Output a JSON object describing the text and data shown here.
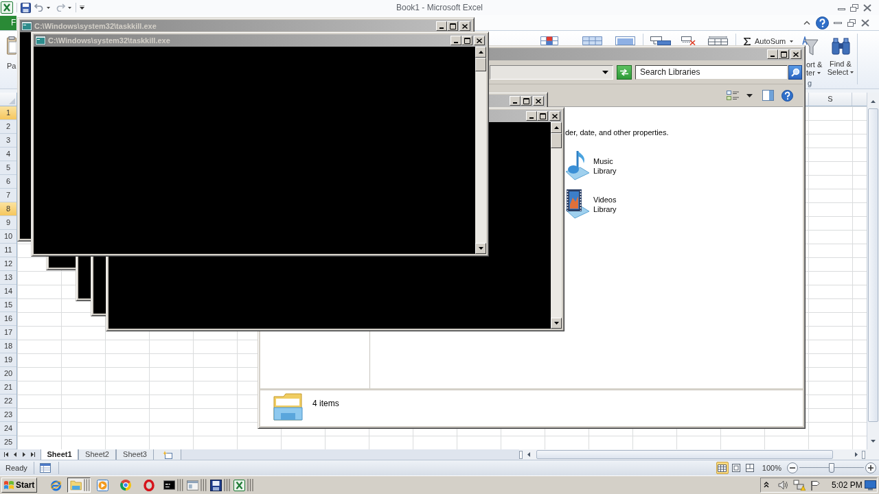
{
  "excel": {
    "title": "Book1 - Microsoft Excel",
    "file_tab": "F",
    "ribbon": {
      "paste": "Pa",
      "autosum": "AutoSum",
      "sort_filter": [
        "ort &",
        "ter"
      ],
      "find_select": [
        "Find &",
        "Select"
      ],
      "editing_group": "g"
    },
    "column_headers": [
      "S"
    ],
    "rows": [
      {
        "label": "1",
        "selected": true
      },
      {
        "label": "2",
        "selected": false
      },
      {
        "label": "3",
        "selected": false
      },
      {
        "label": "4",
        "selected": false
      },
      {
        "label": "5",
        "selected": false
      },
      {
        "label": "6",
        "selected": false
      },
      {
        "label": "7",
        "selected": false
      },
      {
        "label": "8",
        "selected": true
      },
      {
        "label": "9",
        "selected": false
      },
      {
        "label": "10",
        "selected": false
      },
      {
        "label": "11",
        "selected": false
      },
      {
        "label": "12",
        "selected": false
      },
      {
        "label": "13",
        "selected": false
      },
      {
        "label": "14",
        "selected": false
      },
      {
        "label": "15",
        "selected": false
      },
      {
        "label": "16",
        "selected": false
      },
      {
        "label": "17",
        "selected": false
      },
      {
        "label": "18",
        "selected": false
      },
      {
        "label": "19",
        "selected": false
      },
      {
        "label": "20",
        "selected": false
      },
      {
        "label": "21",
        "selected": false
      },
      {
        "label": "22",
        "selected": false
      },
      {
        "label": "23",
        "selected": false
      },
      {
        "label": "24",
        "selected": false
      },
      {
        "label": "25",
        "selected": false
      }
    ],
    "sheet_tabs": [
      {
        "label": "Sheet1",
        "selected": true
      },
      {
        "label": "Sheet2",
        "selected": false
      },
      {
        "label": "Sheet3",
        "selected": false
      }
    ],
    "status": "Ready",
    "view_buttons": [
      {
        "kind": "normal",
        "selected": true
      },
      {
        "kind": "page_layout",
        "selected": false
      },
      {
        "kind": "page_break",
        "selected": false
      }
    ],
    "zoom": {
      "reading": "100%",
      "level": 0.5
    }
  },
  "console_windows": [
    {
      "title": "C:\\Windows\\system32\\taskkill.exe"
    },
    {
      "title": "C:\\Windows\\system32\\taskkill.exe"
    }
  ],
  "explorer": {
    "search": {
      "placeholder": "Search Libraries"
    },
    "hint": "der, date, and other properties.",
    "libraries": [
      {
        "kind": "music",
        "label": "Music Library"
      },
      {
        "kind": "videos",
        "label": "Videos Library"
      }
    ],
    "details": "4 items"
  },
  "taskbar": {
    "start": "Start",
    "items": [
      {
        "kind": "browser",
        "selected": false,
        "grouped": false
      },
      {
        "kind": "explorer",
        "selected": true,
        "grouped": true
      },
      {
        "kind": "media",
        "selected": false,
        "grouped": false
      },
      {
        "kind": "chrome",
        "selected": false,
        "grouped": false
      },
      {
        "kind": "opera",
        "selected": false,
        "grouped": false
      },
      {
        "kind": "console",
        "selected": false,
        "grouped": true
      },
      {
        "kind": "window",
        "selected": false,
        "grouped": true
      },
      {
        "kind": "disk",
        "selected": false,
        "grouped": true
      },
      {
        "kind": "excel",
        "selected": false,
        "grouped": true
      }
    ],
    "clock": "5:02 PM"
  }
}
